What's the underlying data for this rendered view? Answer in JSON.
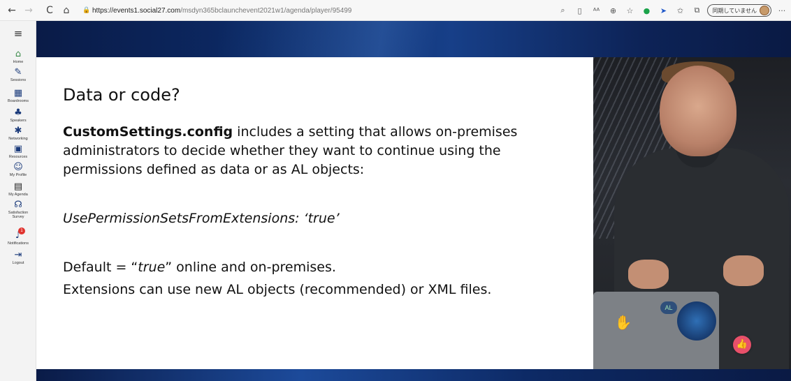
{
  "browser": {
    "back_glyph": "←",
    "forward_glyph": "→",
    "reload_glyph": "C",
    "home_glyph": "⌂",
    "lock_glyph": "🔒",
    "url_host": "https://events1.social27.com",
    "url_path": "/msdyn365bclaunchevent2021w1/agenda/player/95499",
    "profile_label": "同期していません",
    "more_glyph": "···"
  },
  "sidebar": {
    "menu_glyph": "≡",
    "items": [
      {
        "icon": "home-icon",
        "glyph": "⌂",
        "label": "Home"
      },
      {
        "icon": "pen-icon",
        "glyph": "✎",
        "label": "Sessions"
      },
      {
        "icon": "boardroom-icon",
        "glyph": "▦",
        "label": "Boardrooms"
      },
      {
        "icon": "speaker-icon",
        "glyph": "♣",
        "label": "Speakers"
      },
      {
        "icon": "network-icon",
        "glyph": "✱",
        "label": "Networking"
      },
      {
        "icon": "resources-icon",
        "glyph": "▣",
        "label": "Resources"
      },
      {
        "icon": "profile-icon",
        "glyph": "☺",
        "label": "My Profile"
      },
      {
        "icon": "calendar-icon",
        "glyph": "▤",
        "label": "My Agenda"
      },
      {
        "icon": "survey-icon",
        "glyph": "☊",
        "label": "Satisfaction Survey"
      },
      {
        "icon": "bell-icon",
        "glyph": "♪",
        "label": "Notifications",
        "badge": "1"
      },
      {
        "icon": "logout-icon",
        "glyph": "⇥",
        "label": "Logout"
      }
    ]
  },
  "slide": {
    "title": "Data or code?",
    "para_bold": "CustomSettings.config",
    "para_rest": " includes a setting that allows on-premises administrators to decide whether they want to continue using the permissions defined as data or as AL objects:",
    "code_line": "UsePermissionSetsFromExtensions: ‘true’",
    "line1_prefix": "Default = “",
    "line1_italic": "true",
    "line1_suffix": "” online and on-premises.",
    "line2": "Extensions can use new AL objects (recommended) or XML files."
  },
  "video": {
    "sticker_text": "AL"
  },
  "reaction": {
    "glyph": "👍"
  }
}
